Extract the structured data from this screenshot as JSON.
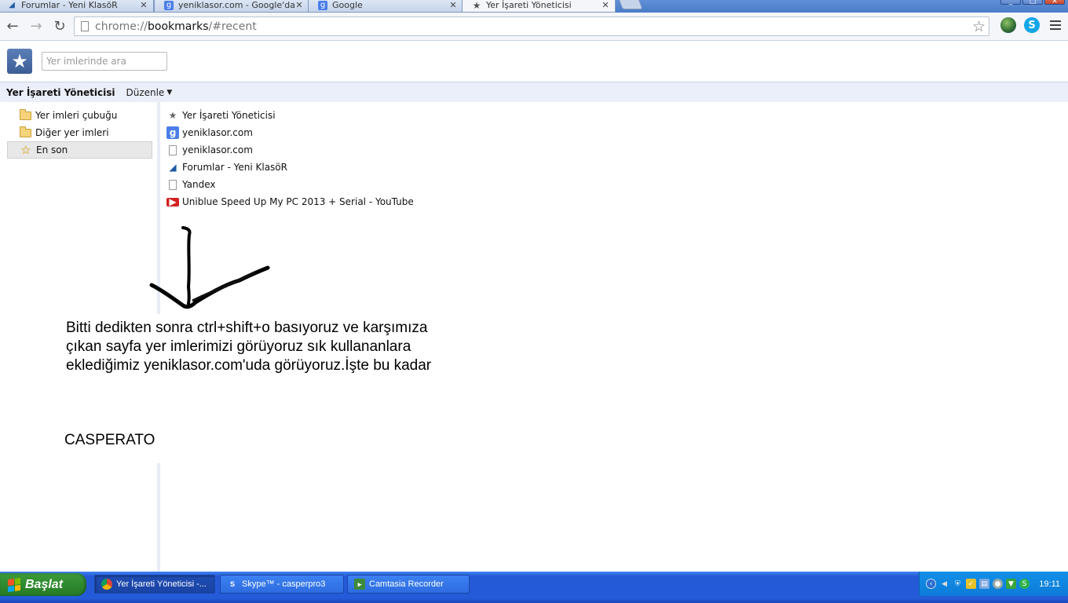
{
  "tabs": [
    {
      "title": "Forumlar - Yeni KlasöR",
      "icon": "forum-icon"
    },
    {
      "title": "yeniklasor.com - Google'da A",
      "icon": "google-icon"
    },
    {
      "title": "Google",
      "icon": "google-icon"
    },
    {
      "title": "Yer İşareti Yöneticisi",
      "icon": "star-icon"
    }
  ],
  "omnibox": {
    "scheme": "chrome://",
    "host": "bookmarks",
    "path": "/#recent"
  },
  "bookmarks": {
    "search_placeholder": "Yer imlerinde ara",
    "title": "Yer İşareti Yöneticisi",
    "organize_label": "Düzenle",
    "tree": [
      {
        "label": "Yer imleri çubuğu"
      },
      {
        "label": "Diğer yer imleri"
      },
      {
        "label": "En son",
        "selected": true
      }
    ],
    "list": [
      {
        "label": "Yer İşareti Yöneticisi",
        "icon": "star-icon"
      },
      {
        "label": "yeniklasor.com",
        "icon": "google-icon"
      },
      {
        "label": "yeniklasor.com",
        "icon": "page-icon"
      },
      {
        "label": "Forumlar - Yeni KlasöR",
        "icon": "forum-icon"
      },
      {
        "label": "Yandex",
        "icon": "page-icon"
      },
      {
        "label": "Uniblue Speed Up My PC 2013 + Serial - YouTube",
        "icon": "youtube-icon"
      }
    ]
  },
  "annotation": {
    "text": "Bitti dedikten sonra ctrl+shift+o basıyoruz ve karşımıza çıkan sayfa yer imlerimizi görüyoruz sık kullananlara eklediğimiz yeniklasor.com'uda görüyoruz.İşte bu kadar",
    "signature": "CASPERATO"
  },
  "taskbar": {
    "start_label": "Başlat",
    "tasks": [
      {
        "label": "Yer İşareti Yöneticisi -...",
        "icon": "chrome-icon",
        "active": true
      },
      {
        "label": "Skype™ - casperpro3",
        "icon": "skype-icon"
      },
      {
        "label": "Camtasia Recorder",
        "icon": "camtasia-icon"
      }
    ],
    "clock": "19:11"
  },
  "colors": {
    "accent": "#4a7cc8",
    "taskbar": "#245bd8",
    "start": "#2f8a2f"
  }
}
